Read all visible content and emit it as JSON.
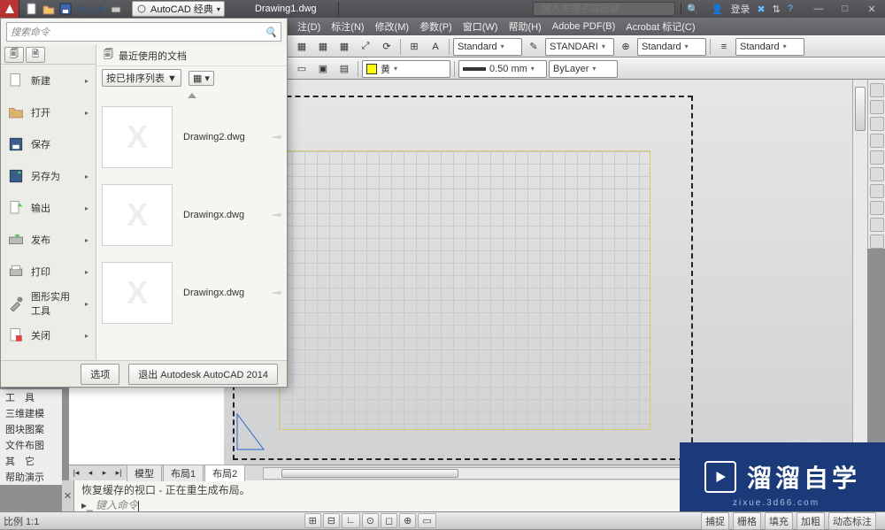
{
  "title": {
    "workspace": "AutoCAD 经典",
    "doc": "Drawing1.dwg",
    "help_placeholder": "键入关键字或短语",
    "login": "登录"
  },
  "menus": {
    "dim": "注(D)",
    "annotate": "标注(N)",
    "modify": "修改(M)",
    "param": "参数(P)",
    "window": "窗口(W)",
    "help": "帮助(H)",
    "adobe": "Adobe PDF(B)",
    "acrobat": "Acrobat 标记(C)"
  },
  "toolbar": {
    "layer_color": "黄",
    "style1": "Standard",
    "style2": "STANDARI",
    "style3": "Standard",
    "lw": "0.50 mm",
    "bylayer": "ByLayer",
    "style4": "Standard"
  },
  "appmenu": {
    "search_placeholder": "搜索命令",
    "left": {
      "new": "新建",
      "open": "打开",
      "save": "保存",
      "saveas": "另存为",
      "export": "输出",
      "publish": "发布",
      "print": "打印",
      "utilities": "图形实用\n工具",
      "close": "关闭"
    },
    "recent": {
      "title": "最近使用的文档",
      "sort": "按已排序列表 ▼",
      "items": [
        "Drawing2.dwg",
        "Drawingx.dwg",
        "Drawingx.dwg"
      ]
    },
    "options": "选项",
    "exit": "退出 Autodesk AutoCAD 2014"
  },
  "sidelist": [
    "工　具",
    "三维建模",
    "图块图案",
    "文件布图",
    "其　它",
    "帮助演示"
  ],
  "layout": {
    "model": "模型",
    "l1": "布局1",
    "l2": "布局2"
  },
  "cmd": {
    "line1": "恢复缓存的视口 - 正在重生成布局。",
    "prompt": "键入命令"
  },
  "status": {
    "scale": "比例 1:1",
    "btns": [
      "捕捉",
      "栅格",
      "填充",
      "加粗",
      "动态标注"
    ]
  },
  "watermark": {
    "text": "溜溜自学",
    "sub": "zixue.3d66.com"
  }
}
